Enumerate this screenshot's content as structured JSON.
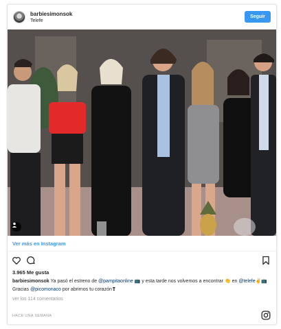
{
  "header": {
    "username": "barbiesimonsok",
    "location": "Telefe",
    "follow_label": "Seguir"
  },
  "photo": {
    "tag_icon": "user-tag-icon"
  },
  "more_link": "Ver más en Instagram",
  "actions": {
    "like_icon": "heart-icon",
    "comment_icon": "comment-icon",
    "save_icon": "bookmark-icon"
  },
  "likes": "3.965 Me gusta",
  "caption": {
    "username": "barbiesimonsok",
    "part1": " Ya pasó el estreno de ",
    "mention1": "@pampitaonline",
    "part2": " 📺 y esta tarde nos volvemos a encontrar 👏 en ",
    "mention2": "@telefe",
    "part3": "✌️📺 Gracias ",
    "mention3": "@picomonaco",
    "part4": " por abrirnos tu corazón❣"
  },
  "comments_link": "ver los 114 comentarios",
  "time_ago": "HACE UNA SEMANA",
  "colors": {
    "accent": "#3897f0",
    "text": "#262626",
    "muted": "#999999"
  }
}
